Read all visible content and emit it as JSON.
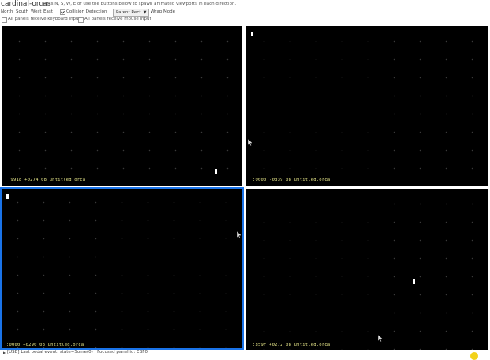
{
  "app": {
    "title": "cardinal-orcas",
    "instructions": "Press N, S, W, E or use the buttons below to spawn animated viewports in each direction."
  },
  "controls": {
    "north": "North",
    "south": "South",
    "west": "West",
    "east": "East",
    "collision_detection": "Collision Detection",
    "collision_checked": true,
    "parent_rect": "Parent Rect",
    "wrap_mode": "Wrap Mode"
  },
  "options": {
    "keyboard": "All panels receive keyboard input",
    "mouse": "All panels receive mouse input"
  },
  "viewports": [
    {
      "status": ":9918 +0274 08 untitled.orca",
      "focused": false
    },
    {
      "status": ":0000 -0339 08 untitled.orca",
      "focused": false
    },
    {
      "status": ":0000 +0290 08 untitled.orca",
      "focused": true
    },
    {
      "status": ":359F +0272 08 untitled.orca",
      "focused": false
    }
  ],
  "statusbar": {
    "text": "[USB] Last pedal event: state=Some(0) | Focused panel id: EBF0"
  },
  "colors": {
    "focus_border": "#1a73e8",
    "status_text": "#e8e88a",
    "viewport_bg": "#000000"
  }
}
